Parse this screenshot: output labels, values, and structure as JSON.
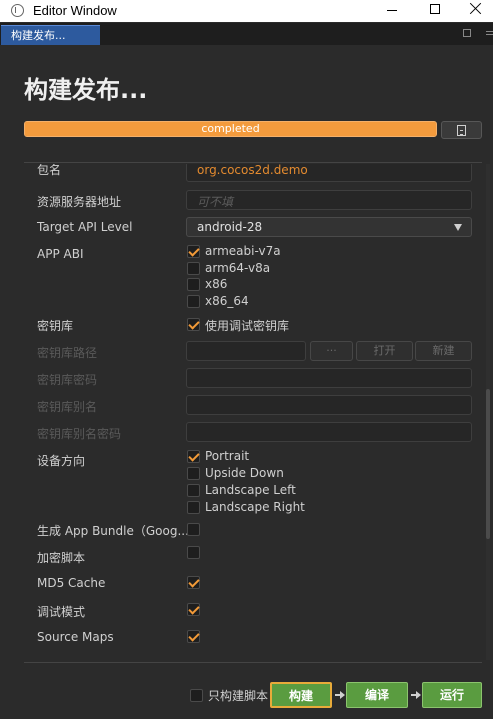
{
  "window": {
    "title": "Editor Window"
  },
  "tab": {
    "label": "构建发布..."
  },
  "header": {
    "title": "构建发布...",
    "progress_label": "completed",
    "progress_value": 1.0
  },
  "form": {
    "package_name_label": "包名",
    "package_name_value": "org.cocos2d.demo",
    "server_label": "资源服务器地址",
    "server_placeholder": "可不填",
    "api_label": "Target API Level",
    "api_value": "android-28",
    "abi_label": "APP ABI",
    "abi_options": [
      {
        "label": "armeabi-v7a",
        "checked": true
      },
      {
        "label": "arm64-v8a",
        "checked": false
      },
      {
        "label": "x86",
        "checked": false
      },
      {
        "label": "x86_64",
        "checked": false
      }
    ],
    "keystore_label": "密钥库",
    "keystore_debug_label": "使用调试密钥库",
    "keystore_path_label": "密钥库路径",
    "keystore_path_dots": "···",
    "keystore_open": "打开",
    "keystore_new": "新建",
    "keystore_password_label": "密钥库密码",
    "keystore_alias_label": "密钥库别名",
    "keystore_alias_password_label": "密钥库别名密码",
    "orientation_label": "设备方向",
    "orientation_options": [
      {
        "label": "Portrait",
        "checked": true
      },
      {
        "label": "Upside Down",
        "checked": false
      },
      {
        "label": "Landscape Left",
        "checked": false
      },
      {
        "label": "Landscape Right",
        "checked": false
      }
    ],
    "app_bundle_label": "生成 App Bundle（Goog...",
    "encrypt_label": "加密脚本",
    "md5_label": "MD5 Cache",
    "debug_label": "调试模式",
    "sourcemaps_label": "Source Maps"
  },
  "footer": {
    "only_build_script": "只构建脚本",
    "build": "构建",
    "compile": "编译",
    "run": "运行"
  },
  "colors": {
    "accent": "#f29a38",
    "button_green": "#5a9c40",
    "tab_active": "#2d5a9e"
  }
}
